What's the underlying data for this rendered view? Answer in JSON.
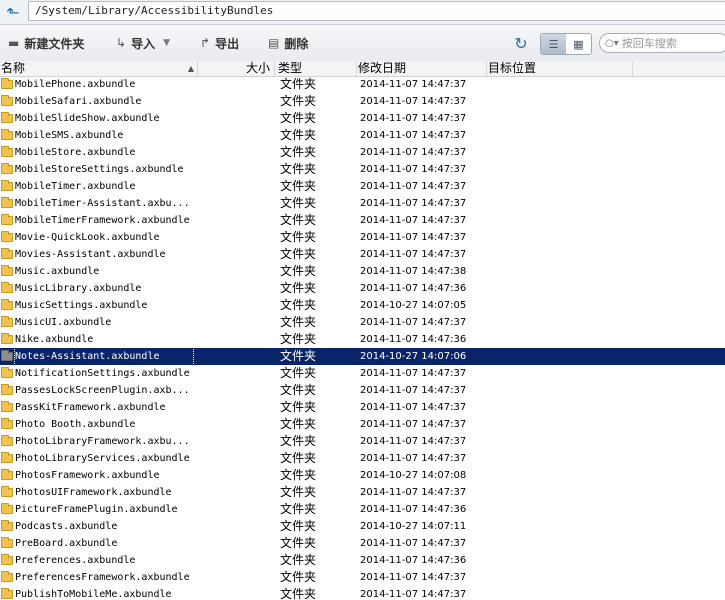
{
  "pathbar": {
    "path": "/System/Library/AccessibilityBundles"
  },
  "toolbar": {
    "new_folder": "新建文件夹",
    "import": "导入",
    "export": "导出",
    "delete": "删除",
    "search_placeholder": "按回车搜索"
  },
  "columns": {
    "name": "名称",
    "size": "大小",
    "type": "类型",
    "modified": "修改日期",
    "target": "目标位置"
  },
  "files": [
    {
      "name": "MobilePhone.axbundle",
      "type": "文件夹",
      "date": "2014-11-07 14:47:37"
    },
    {
      "name": "MobileSafari.axbundle",
      "type": "文件夹",
      "date": "2014-11-07 14:47:37"
    },
    {
      "name": "MobileSlideShow.axbundle",
      "type": "文件夹",
      "date": "2014-11-07 14:47:37"
    },
    {
      "name": "MobileSMS.axbundle",
      "type": "文件夹",
      "date": "2014-11-07 14:47:37"
    },
    {
      "name": "MobileStore.axbundle",
      "type": "文件夹",
      "date": "2014-11-07 14:47:37"
    },
    {
      "name": "MobileStoreSettings.axbundle",
      "type": "文件夹",
      "date": "2014-11-07 14:47:37"
    },
    {
      "name": "MobileTimer.axbundle",
      "type": "文件夹",
      "date": "2014-11-07 14:47:37"
    },
    {
      "name": "MobileTimer-Assistant.axbu...",
      "type": "文件夹",
      "date": "2014-11-07 14:47:37"
    },
    {
      "name": "MobileTimerFramework.axbundle",
      "type": "文件夹",
      "date": "2014-11-07 14:47:37"
    },
    {
      "name": "Movie-QuickLook.axbundle",
      "type": "文件夹",
      "date": "2014-11-07 14:47:37"
    },
    {
      "name": "Movies-Assistant.axbundle",
      "type": "文件夹",
      "date": "2014-11-07 14:47:37"
    },
    {
      "name": "Music.axbundle",
      "type": "文件夹",
      "date": "2014-11-07 14:47:38"
    },
    {
      "name": "MusicLibrary.axbundle",
      "type": "文件夹",
      "date": "2014-11-07 14:47:36"
    },
    {
      "name": "MusicSettings.axbundle",
      "type": "文件夹",
      "date": "2014-10-27 14:07:05"
    },
    {
      "name": "MusicUI.axbundle",
      "type": "文件夹",
      "date": "2014-11-07 14:47:37"
    },
    {
      "name": "Nike.axbundle",
      "type": "文件夹",
      "date": "2014-11-07 14:47:36"
    },
    {
      "name": "Notes-Assistant.axbundle",
      "type": "文件夹",
      "date": "2014-10-27 14:07:06",
      "selected": true
    },
    {
      "name": "NotificationSettings.axbundle",
      "type": "文件夹",
      "date": "2014-11-07 14:47:37"
    },
    {
      "name": "PassesLockScreenPlugin.axb...",
      "type": "文件夹",
      "date": "2014-11-07 14:47:37"
    },
    {
      "name": "PassKitFramework.axbundle",
      "type": "文件夹",
      "date": "2014-11-07 14:47:37"
    },
    {
      "name": "Photo Booth.axbundle",
      "type": "文件夹",
      "date": "2014-11-07 14:47:37"
    },
    {
      "name": "PhotoLibraryFramework.axbu...",
      "type": "文件夹",
      "date": "2014-11-07 14:47:37"
    },
    {
      "name": "PhotoLibraryServices.axbundle",
      "type": "文件夹",
      "date": "2014-11-07 14:47:37"
    },
    {
      "name": "PhotosFramework.axbundle",
      "type": "文件夹",
      "date": "2014-10-27 14:07:08"
    },
    {
      "name": "PhotosUIFramework.axbundle",
      "type": "文件夹",
      "date": "2014-11-07 14:47:37"
    },
    {
      "name": "PictureFramePlugin.axbundle",
      "type": "文件夹",
      "date": "2014-11-07 14:47:36"
    },
    {
      "name": "Podcasts.axbundle",
      "type": "文件夹",
      "date": "2014-10-27 14:07:11"
    },
    {
      "name": "PreBoard.axbundle",
      "type": "文件夹",
      "date": "2014-11-07 14:47:37"
    },
    {
      "name": "Preferences.axbundle",
      "type": "文件夹",
      "date": "2014-11-07 14:47:36"
    },
    {
      "name": "PreferencesFramework.axbundle",
      "type": "文件夹",
      "date": "2014-11-07 14:47:37"
    },
    {
      "name": "PublishToMobileMe.axbundle",
      "type": "文件夹",
      "date": "2014-11-07 14:47:37"
    }
  ]
}
